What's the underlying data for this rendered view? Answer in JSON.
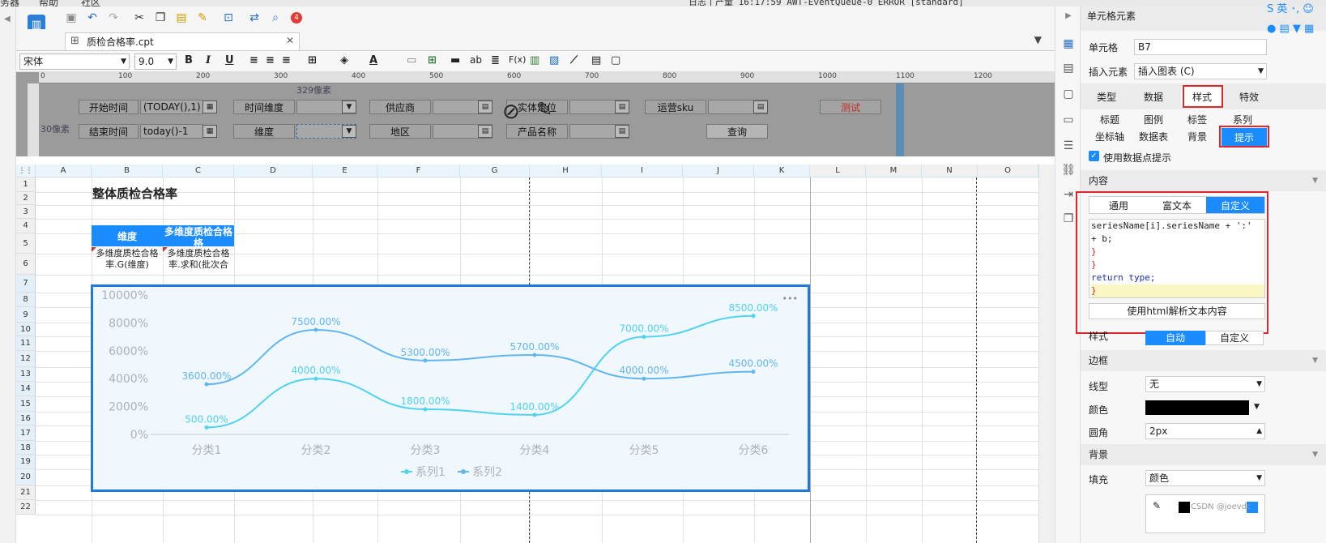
{
  "menubar": {
    "items": [
      "务器",
      "帮助",
      "社区"
    ],
    "log_text": "日志丨产量 16:17:59 AWT-EventQueue-0 ERROR [standard]"
  },
  "toolbar": {
    "badge_count": "4"
  },
  "tab": {
    "title": "质检合格率.cpt",
    "close": "✕"
  },
  "format": {
    "font_name": "宋体",
    "font_size": "9.0",
    "bold": "B",
    "italic": "I",
    "underline": "U",
    "text_ab": "ab",
    "fx": "F(x)"
  },
  "ruler": {
    "ticks": [
      "0",
      "100",
      "200",
      "300",
      "400",
      "500",
      "600",
      "700",
      "800",
      "900",
      "1000",
      "1100",
      "1200"
    ],
    "px_label_top": "329像素",
    "px_label_left": "30像素"
  },
  "params": {
    "start_time_label": "开始时间",
    "start_time_value": "(TODAY(),1)",
    "end_time_label": "结束时间",
    "end_time_value": "today()-1",
    "time_dim_label": "时间维度",
    "dim_label": "维度",
    "supplier_label": "供应商",
    "region_label": "地区",
    "store_label": "实体定位",
    "product_label": "产品名称",
    "ops_label": "运营sku",
    "test_label": "测试",
    "query_button": "查询"
  },
  "sheet": {
    "columns": [
      "A",
      "B",
      "C",
      "D",
      "E",
      "F",
      "G",
      "H",
      "I",
      "J",
      "K",
      "L",
      "M",
      "N",
      "O"
    ],
    "rows": [
      "1",
      "2",
      "3",
      "4",
      "5",
      "6",
      "7",
      "8",
      "9",
      "10",
      "11",
      "12",
      "13",
      "14",
      "15",
      "16",
      "17",
      "18",
      "19",
      "20",
      "21",
      "22"
    ],
    "title": "整体质检合格率",
    "header_dim": "维度",
    "header_rate": "多维度质检合格格",
    "cell_b5": "多维度质检合格率.G(维度)",
    "cell_c5": "多维度质检合格率.求和(批次合"
  },
  "chart_data": {
    "type": "line",
    "categories": [
      "分类1",
      "分类2",
      "分类3",
      "分类4",
      "分类5",
      "分类6"
    ],
    "series": [
      {
        "name": "系列1",
        "values": [
          500,
          4000,
          1800,
          1400,
          7000,
          8500
        ],
        "color": "#4fd3ef"
      },
      {
        "name": "系列2",
        "values": [
          3600,
          7500,
          5300,
          5700,
          4000,
          4500
        ],
        "color": "#62b6f0"
      }
    ],
    "yticks": [
      "0%",
      "2000%",
      "4000%",
      "6000%",
      "8000%",
      "10000%"
    ],
    "ylim": [
      0,
      10000
    ],
    "legend": "bottom",
    "more": "•••"
  },
  "panel": {
    "title": "单元格元素",
    "cell_label": "单元格",
    "cell_value": "B7",
    "insert_label": "插入元素",
    "insert_value": "插入图表 (C)",
    "tabs": [
      "类型",
      "数据",
      "样式",
      "特效"
    ],
    "subtabs1": [
      "标题",
      "图例",
      "标签",
      "系列"
    ],
    "subtabs2": [
      "坐标轴",
      "数据表",
      "背景",
      "提示"
    ],
    "use_tooltip": "使用数据点提示",
    "content_section": "内容",
    "content_tabs": [
      "通用",
      "富文本",
      "自定义"
    ],
    "code_lines": [
      "seriesName[i].seriesName + ':'",
      "+ b;",
      "}",
      "}",
      "return type;",
      "}"
    ],
    "html_button": "使用html解析文本内容",
    "style_label": "样式",
    "style_auto": "自动",
    "style_custom": "自定义",
    "border_section": "边框",
    "line_type_label": "线型",
    "line_type_value": "无",
    "color_label": "颜色",
    "radius_label": "圆角",
    "radius_value": "2px",
    "bg_section": "背景",
    "fill_label": "填充",
    "fill_value": "颜色",
    "watermark": "CSDN @joevdc"
  },
  "colors": {
    "accent": "#1a8cff",
    "red": "#e0252b",
    "panel_bg": "#f7f7f7"
  }
}
